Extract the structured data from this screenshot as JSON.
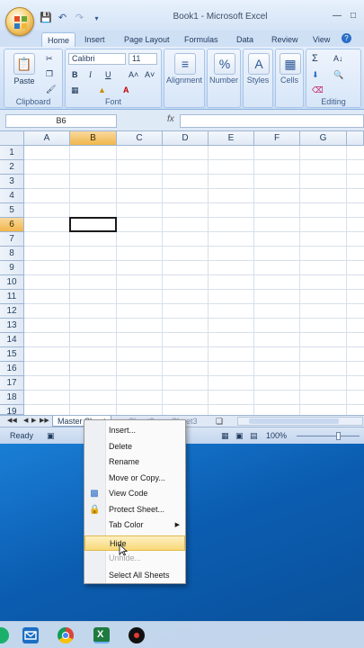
{
  "window": {
    "title": "Book1 - Microsoft Excel"
  },
  "ribbon_tabs": [
    "Home",
    "Insert",
    "Page Layout",
    "Formulas",
    "Data",
    "Review",
    "View"
  ],
  "ribbon": {
    "clipboard": {
      "label": "Clipboard",
      "paste": "Paste"
    },
    "font": {
      "label": "Font",
      "name": "Calibri",
      "size": "11",
      "bold": "B",
      "italic": "I",
      "underline": "U",
      "grow": "A˄",
      "shrink": "A˅"
    },
    "alignment": "Alignment",
    "number": "Number",
    "styles": "Styles",
    "cells": "Cells",
    "editing": "Editing",
    "sigma": "Σ",
    "sort": "A↓"
  },
  "formula_bar": {
    "name_box": "B6",
    "fx": "fx",
    "value": ""
  },
  "columns": [
    "A",
    "B",
    "C",
    "D",
    "E",
    "F",
    "G"
  ],
  "rows": [
    "1",
    "2",
    "3",
    "4",
    "5",
    "6",
    "7",
    "8",
    "9",
    "10",
    "11",
    "12",
    "13",
    "14",
    "15",
    "16",
    "17",
    "18",
    "19"
  ],
  "selected_cell": {
    "column": "B",
    "row": "6"
  },
  "sheet_tabs": [
    "Master Sheet",
    "Sheet2",
    "Sheet3"
  ],
  "status": {
    "ready": "Ready",
    "zoom": "100%"
  },
  "context_menu": {
    "items": [
      {
        "label": "Insert...",
        "icon": ""
      },
      {
        "label": "Delete",
        "icon": ""
      },
      {
        "label": "Rename",
        "icon": ""
      },
      {
        "label": "Move or Copy...",
        "icon": ""
      },
      {
        "label": "View Code",
        "icon": "view-code-icon"
      },
      {
        "label": "Protect Sheet...",
        "icon": "protect-sheet-icon"
      },
      {
        "label": "Tab Color",
        "icon": "",
        "submenu": true
      },
      {
        "label": "Hide",
        "icon": "",
        "highlighted": true
      },
      {
        "label": "Unhide...",
        "icon": "",
        "disabled": true
      },
      {
        "label": "Select All Sheets",
        "icon": ""
      }
    ]
  },
  "taskbar": [
    "mail-icon",
    "chrome-icon",
    "excel-icon",
    "recorder-icon"
  ],
  "colors": {
    "accent": "#f1b649",
    "ribbon": "#c7dbf3",
    "desktop": "#0b5db1"
  }
}
